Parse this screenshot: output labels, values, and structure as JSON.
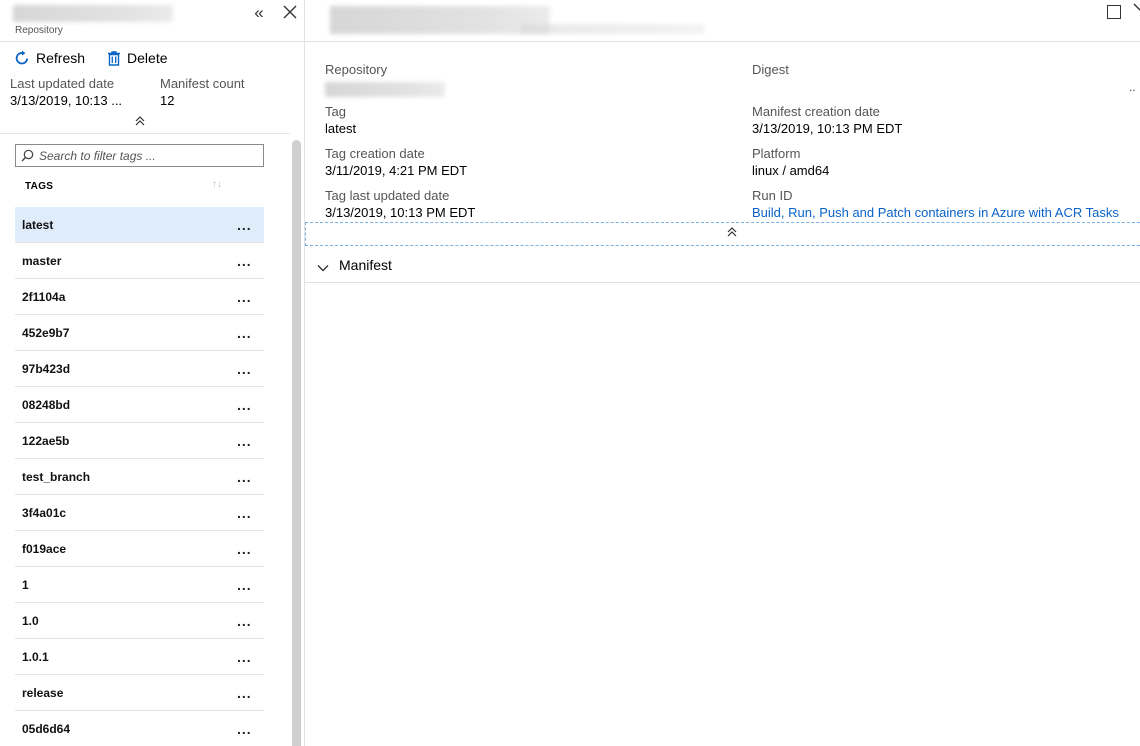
{
  "left_pane": {
    "subtitle": "Repository",
    "toolbar": {
      "refresh_label": "Refresh",
      "delete_label": "Delete"
    },
    "meta": {
      "last_updated_label": "Last updated date",
      "last_updated_value": "3/13/2019, 10:13 ...",
      "manifest_count_label": "Manifest count",
      "manifest_count_value": "12"
    },
    "search": {
      "placeholder": "Search to filter tags ..."
    },
    "tags_header": "TAGS",
    "tags": [
      {
        "name": "latest",
        "selected": true
      },
      {
        "name": "master"
      },
      {
        "name": "2f1104a"
      },
      {
        "name": "452e9b7"
      },
      {
        "name": "97b423d"
      },
      {
        "name": "08248bd"
      },
      {
        "name": "122ae5b"
      },
      {
        "name": "test_branch"
      },
      {
        "name": "3f4a01c"
      },
      {
        "name": "f019ace"
      },
      {
        "name": "1"
      },
      {
        "name": "1.0"
      },
      {
        "name": "1.0.1"
      },
      {
        "name": "release"
      },
      {
        "name": "05d6d64"
      }
    ],
    "more_glyph": "..."
  },
  "details": {
    "repository_label": "Repository",
    "digest_label": "Digest",
    "digest_overflow": "..",
    "tag_label": "Tag",
    "tag_value": "latest",
    "manifest_creation_label": "Manifest creation date",
    "manifest_creation_value": "3/13/2019, 10:13 PM EDT",
    "tag_creation_label": "Tag creation date",
    "tag_creation_value": "3/11/2019, 4:21 PM EDT",
    "platform_label": "Platform",
    "platform_value": "linux / amd64",
    "tag_last_updated_label": "Tag last updated date",
    "tag_last_updated_value": "3/13/2019, 10:13 PM EDT",
    "run_id_label": "Run ID",
    "run_id_value": "Build, Run, Push and Patch containers in Azure with ACR Tasks"
  },
  "manifest_section": {
    "title": "Manifest"
  },
  "icons": {
    "collapse": "double-chevron-left-icon",
    "close": "close-icon",
    "refresh": "refresh-icon",
    "delete": "trash-icon",
    "search": "search-icon",
    "sort": "sort-icon",
    "more": "more-icon",
    "maximize": "maximize-icon",
    "expand_toggle": "double-chevron-up-icon",
    "section_chevron": "chevron-down-icon"
  },
  "colors": {
    "accent": "#0a63c8",
    "selected_row": "#dfecfa",
    "divider": "#e0e0e0"
  }
}
